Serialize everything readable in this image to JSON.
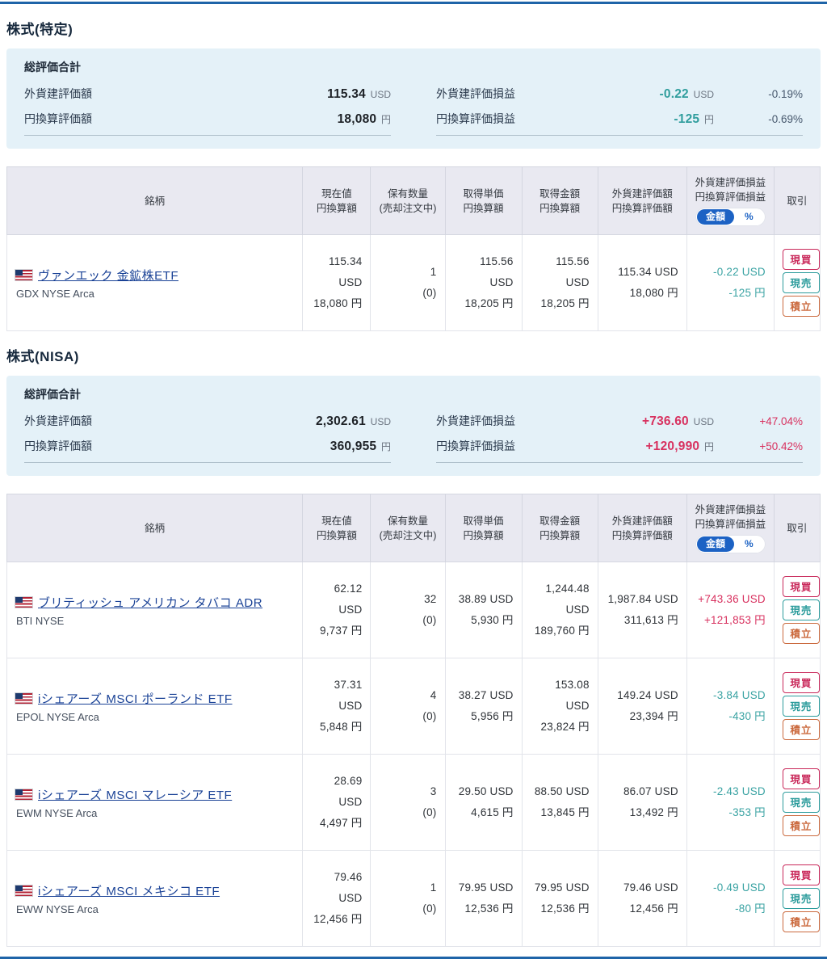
{
  "colors": {
    "accent_rule_blue": "#1e64a8",
    "summary_bg": "#e4f1f8",
    "table_header_bg": "#e9e9f1",
    "link_navy": "#1a4296",
    "loss_teal": "#3aa3a3",
    "profit_pink": "#d8315f",
    "toggle_blue": "#1c62c4",
    "buy_red": "#c9285a",
    "sell_teal": "#2c9c9c",
    "reserve_orange": "#cb6a3e"
  },
  "trade_buttons": {
    "buy": "現買",
    "sell": "現売",
    "reserve": "積立"
  },
  "toggle": {
    "amount": "金額",
    "percent": "%"
  },
  "table_header": {
    "name": "銘柄",
    "current_1": "現在値",
    "current_2": "円換算額",
    "qty_1": "保有数量",
    "qty_2": "(売却注文中)",
    "unit_1": "取得単価",
    "unit_2": "円換算額",
    "amount_1": "取得金額",
    "amount_2": "円換算額",
    "value_1": "外貨建評価額",
    "value_2": "円換算評価額",
    "pl_1": "外貨建評価損益",
    "pl_2": "円換算評価損益",
    "trade": "取引"
  },
  "sections": [
    {
      "heading": "株式(特定)",
      "summary": {
        "title": "総評価合計",
        "foreign_value": {
          "label": "外貨建評価額",
          "value": "115.34",
          "unit": "USD"
        },
        "yen_value": {
          "label": "円換算評価額",
          "value": "18,080",
          "unit": "円"
        },
        "foreign_pl": {
          "label": "外貨建評価損益",
          "value": "-0.22",
          "unit": "USD",
          "pct": "-0.19%"
        },
        "yen_pl": {
          "label": "円換算評価損益",
          "value": "-125",
          "unit": "円",
          "pct": "-0.69%"
        }
      },
      "table": {
        "rows": [
          {
            "name": "ヴァンエック 金鉱株ETF",
            "ticker": "GDX NYSE Arca",
            "current_usd": "115.34 USD",
            "current_jpy": "18,080 円",
            "qty": "1",
            "qty_order": "(0)",
            "unit_usd": "115.56 USD",
            "unit_jpy": "18,205 円",
            "amount_usd": "115.56 USD",
            "amount_jpy": "18,205 円",
            "value_usd": "115.34 USD",
            "value_jpy": "18,080 円",
            "pl_usd": "-0.22 USD",
            "pl_jpy": "-125 円"
          }
        ]
      }
    },
    {
      "heading": "株式(NISA)",
      "summary": {
        "title": "総評価合計",
        "foreign_value": {
          "label": "外貨建評価額",
          "value": "2,302.61",
          "unit": "USD"
        },
        "yen_value": {
          "label": "円換算評価額",
          "value": "360,955",
          "unit": "円"
        },
        "foreign_pl": {
          "label": "外貨建評価損益",
          "value": "+736.60",
          "unit": "USD",
          "pct": "+47.04%"
        },
        "yen_pl": {
          "label": "円換算評価損益",
          "value": "+120,990",
          "unit": "円",
          "pct": "+50.42%"
        }
      },
      "table": {
        "rows": [
          {
            "name": "ブリティッシュ アメリカン タバコ ADR",
            "ticker": "BTI NYSE",
            "current_usd": "62.12 USD",
            "current_jpy": "9,737 円",
            "qty": "32",
            "qty_order": "(0)",
            "unit_usd": "38.89 USD",
            "unit_jpy": "5,930 円",
            "amount_usd": "1,244.48 USD",
            "amount_jpy": "189,760 円",
            "value_usd": "1,987.84 USD",
            "value_jpy": "311,613 円",
            "pl_usd": "+743.36 USD",
            "pl_jpy": "+121,853 円"
          },
          {
            "name": "iシェアーズ MSCI ポーランド ETF",
            "ticker": "EPOL NYSE Arca",
            "current_usd": "37.31 USD",
            "current_jpy": "5,848 円",
            "qty": "4",
            "qty_order": "(0)",
            "unit_usd": "38.27 USD",
            "unit_jpy": "5,956 円",
            "amount_usd": "153.08 USD",
            "amount_jpy": "23,824 円",
            "value_usd": "149.24 USD",
            "value_jpy": "23,394 円",
            "pl_usd": "-3.84 USD",
            "pl_jpy": "-430 円"
          },
          {
            "name": "iシェアーズ MSCI マレーシア ETF",
            "ticker": "EWM NYSE Arca",
            "current_usd": "28.69 USD",
            "current_jpy": "4,497 円",
            "qty": "3",
            "qty_order": "(0)",
            "unit_usd": "29.50 USD",
            "unit_jpy": "4,615 円",
            "amount_usd": "88.50 USD",
            "amount_jpy": "13,845 円",
            "value_usd": "86.07 USD",
            "value_jpy": "13,492 円",
            "pl_usd": "-2.43 USD",
            "pl_jpy": "-353 円"
          },
          {
            "name": "iシェアーズ MSCI メキシコ ETF",
            "ticker": "EWW NYSE Arca",
            "current_usd": "79.46 USD",
            "current_jpy": "12,456 円",
            "qty": "1",
            "qty_order": "(0)",
            "unit_usd": "79.95 USD",
            "unit_jpy": "12,536 円",
            "amount_usd": "79.95 USD",
            "amount_jpy": "12,536 円",
            "value_usd": "79.46 USD",
            "value_jpy": "12,456 円",
            "pl_usd": "-0.49 USD",
            "pl_jpy": "-80 円"
          }
        ]
      }
    }
  ]
}
